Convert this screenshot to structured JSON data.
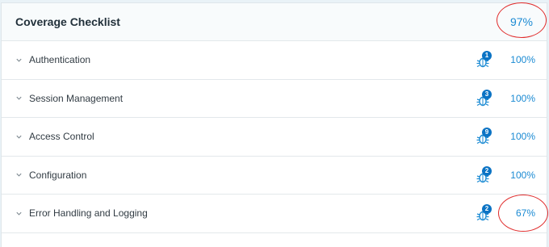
{
  "checklist": {
    "title": "Coverage Checklist",
    "total_percent": "97%",
    "items": [
      {
        "label": "Authentication",
        "issues": "1",
        "percent": "100%"
      },
      {
        "label": "Session Management",
        "issues": "3",
        "percent": "100%"
      },
      {
        "label": "Access Control",
        "issues": "9",
        "percent": "100%"
      },
      {
        "label": "Configuration",
        "issues": "2",
        "percent": "100%"
      },
      {
        "label": "Error Handling and Logging",
        "issues": "2",
        "percent": "67%"
      }
    ]
  },
  "colors": {
    "accent": "#1a8ad3",
    "badge": "#0b73c4",
    "highlight": "#e02c2c"
  },
  "icons": {
    "row_expand": "chevron-down-icon",
    "issues": "bug-icon"
  }
}
